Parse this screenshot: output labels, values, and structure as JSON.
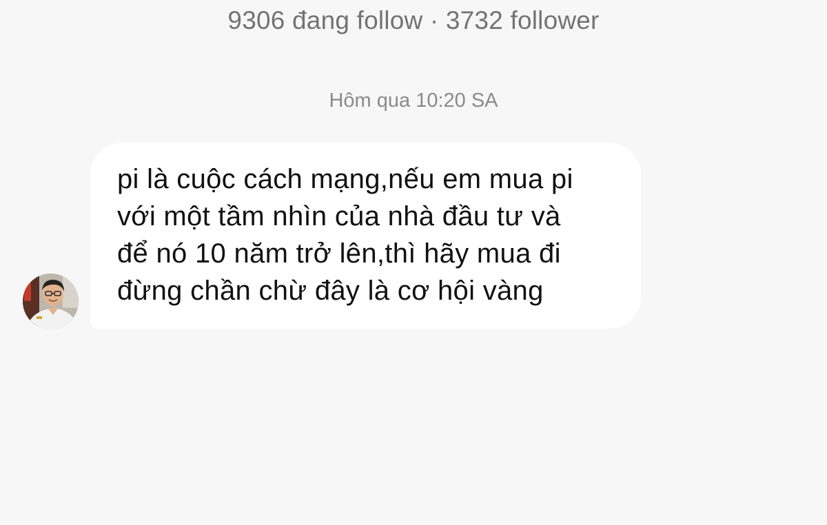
{
  "profile": {
    "stats": "9306 đang follow · 3732 follower"
  },
  "thread": {
    "timestamp": "Hôm qua 10:20 SA"
  },
  "message": {
    "lines": [
      "pi là cuộc cách mạng,nếu em mua pi",
      "với một tầm nhìn của nhà đầu tư và",
      "để nó 10 năm trở lên,thì hãy mua đi",
      "đừng chần chừ đây là cơ hội vàng"
    ]
  },
  "colors": {
    "background": "#f7f7f7",
    "bubble": "#ffffff",
    "secondary_text": "#737373"
  }
}
